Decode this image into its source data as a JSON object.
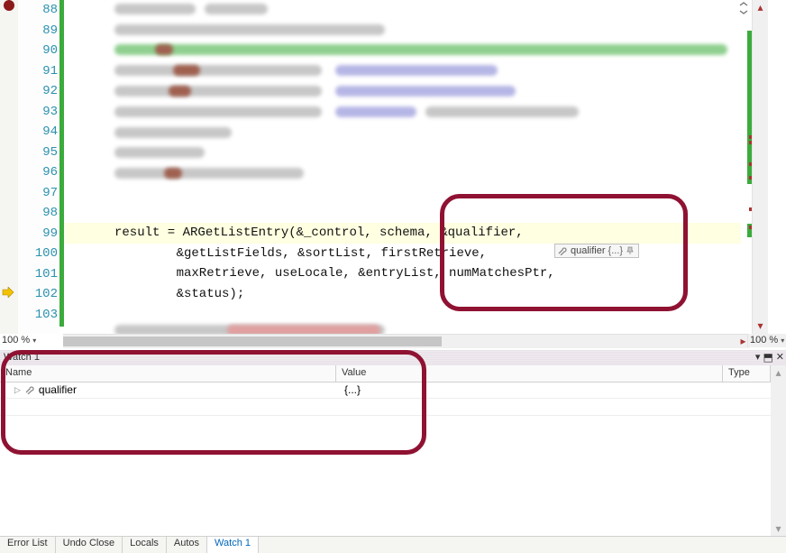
{
  "editor": {
    "line_numbers": [
      "88",
      "89",
      "90",
      "91",
      "92",
      "93",
      "94",
      "95",
      "96",
      "97",
      "98",
      "99",
      "100",
      "101",
      "102",
      "103"
    ],
    "code": {
      "l99": "result = ARGetListEntry(&_control, schema, &qualifier,",
      "l100": "    &getListFields, &sortList, firstRetrieve,",
      "l101": "    maxRetrieve, useLocale, &entryList, numMatchesPtr,",
      "l102": "    &status);"
    },
    "zoom_left": "100 %",
    "zoom_right": "100 %"
  },
  "tooltip": {
    "name": "qualifier",
    "value": "{...}"
  },
  "watch": {
    "title": "Watch 1",
    "columns": {
      "name": "Name",
      "value": "Value",
      "type": "Type"
    },
    "rows": [
      {
        "name": "qualifier",
        "value": "{...}",
        "type": ""
      }
    ]
  },
  "bottom_tabs": {
    "items": [
      "Error List",
      "Undo Close",
      "Locals",
      "Autos",
      "Watch 1"
    ],
    "active_index": 4
  }
}
